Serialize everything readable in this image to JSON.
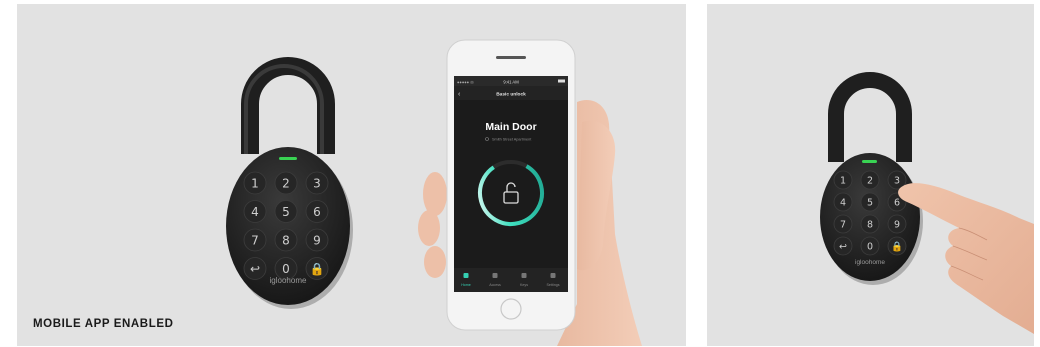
{
  "caption": "MOBILE APP ENABLED",
  "lock": {
    "brand": "igloohome",
    "keys": [
      "1",
      "2",
      "3",
      "4",
      "5",
      "6",
      "7",
      "8",
      "9",
      "↩",
      "0",
      "🔒"
    ]
  },
  "phone": {
    "status_left": "●●●●● ◎",
    "status_time": "9:41 AM",
    "header_title": "Basic unlock",
    "lock_name": "Main Door",
    "lock_location": "Smith Street Apartment",
    "tabs": [
      "Home",
      "Access",
      "Keys",
      "Settings"
    ]
  },
  "colors": {
    "background": "#e2e2e2",
    "lock_body": "#1c1c1c",
    "led": "#39d353",
    "unlock_ring": "#35d0b3"
  }
}
